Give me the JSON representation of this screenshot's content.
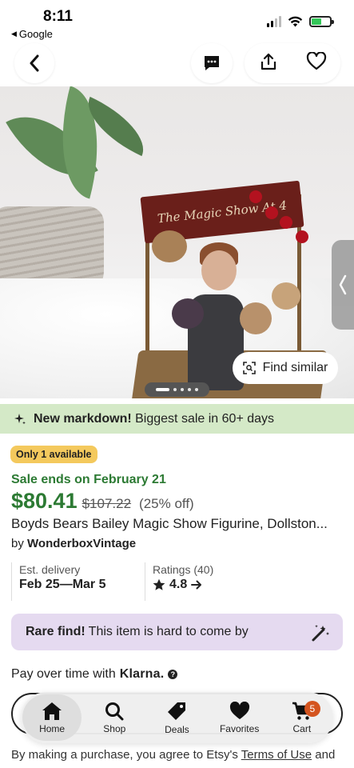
{
  "status_bar": {
    "time": "8:11",
    "back_app": "Google"
  },
  "hero": {
    "banner_text": "The Magic Show At 4",
    "find_similar_label": "Find similar",
    "carousel_pages": 5,
    "carousel_active": 1
  },
  "markdown_banner": {
    "bold": "New markdown!",
    "text": " Biggest sale in 60+ days"
  },
  "product": {
    "availability_badge": "Only 1 available",
    "sale_ends": "Sale ends on February 21",
    "price": "$80.41",
    "original_price": "$107.22",
    "discount": "(25% off)",
    "title": "Boyds Bears Bailey Magic Show Figurine, Dollston...",
    "seller_prefix": "by ",
    "seller_name": "WonderboxVintage"
  },
  "meta": {
    "delivery_label": "Est. delivery",
    "delivery_value": "Feb 25—Mar 5",
    "ratings_label": "Ratings (40)",
    "ratings_value": "4.8"
  },
  "rare_find": {
    "bold": "Rare find!",
    "text": "This item is hard to come by"
  },
  "klarna": {
    "text": "Pay over time with",
    "brand": "Klarna."
  },
  "bottom_nav": {
    "items": [
      {
        "label": "Home",
        "icon": "home-icon"
      },
      {
        "label": "Shop",
        "icon": "search-icon"
      },
      {
        "label": "Deals",
        "icon": "tag-icon"
      },
      {
        "label": "Favorites",
        "icon": "heart-icon"
      },
      {
        "label": "Cart",
        "icon": "cart-icon"
      }
    ],
    "active": "Home",
    "cart_count": "5"
  },
  "legal": {
    "prefix": "By making a purchase, you agree to Etsy's ",
    "link": "Terms of Use",
    "suffix": " and"
  },
  "colors": {
    "sale_green": "#2c7a33",
    "markdown_bg": "#d4e9c7",
    "badge_yellow": "#f4c95d",
    "rare_bg": "#e5daf0",
    "cart_badge": "#d4541f"
  }
}
